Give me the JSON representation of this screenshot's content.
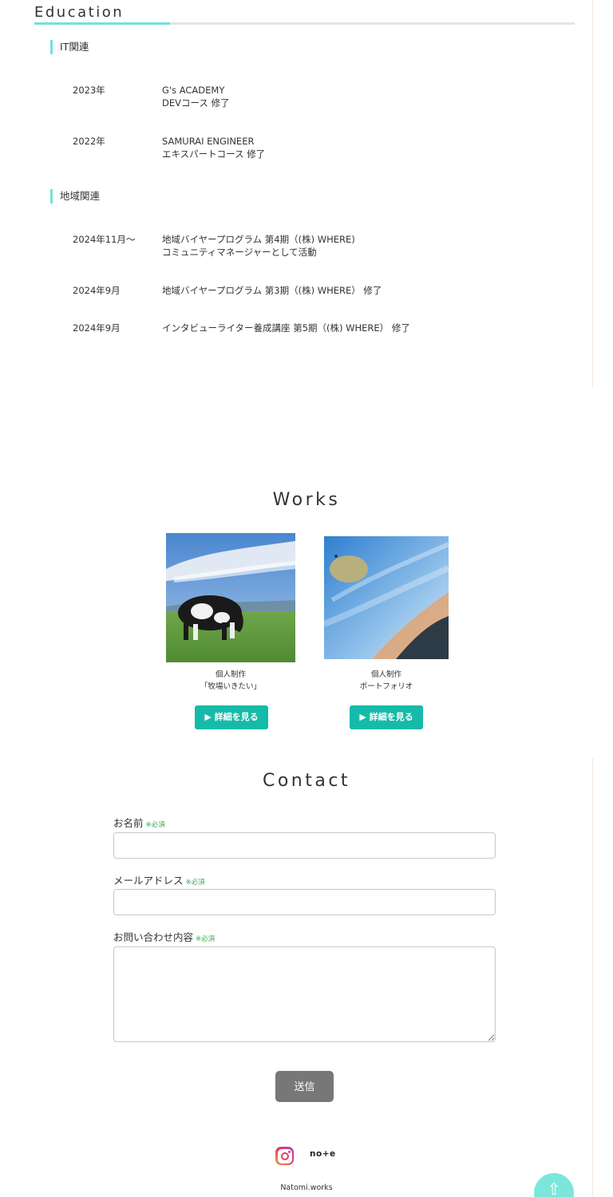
{
  "education": {
    "title": "Education",
    "groups": [
      {
        "heading": "IT関連",
        "entries": [
          {
            "year": "2023年",
            "desc": "G's ACADEMY\nDEVコース 修了"
          },
          {
            "year": "2022年",
            "desc": "SAMURAI ENGINEER\nエキスパートコース 修了"
          }
        ]
      },
      {
        "heading": "地域関連",
        "entries": [
          {
            "year": "2024年11月〜",
            "desc": "地域バイヤープログラム 第4期（(株) WHERE)\nコミュニティマネージャーとして活動"
          },
          {
            "year": "2024年9月",
            "desc": "地域バイヤープログラム 第3期（(株) WHERE） 修了"
          },
          {
            "year": "2024年9月",
            "desc": "インタビューライター養成講座 第5期（(株) WHERE） 修了"
          }
        ]
      }
    ]
  },
  "works": {
    "title": "Works",
    "items": [
      {
        "caption": "個人制作\n「牧場いきたい」",
        "button": "▶ 詳細を見る"
      },
      {
        "caption": "個人制作\nポートフォリオ",
        "button": "▶ 詳細を見る"
      }
    ]
  },
  "contact": {
    "title": "Contact",
    "required_mark": "※必須",
    "name_label": "お名前",
    "email_label": "メールアドレス",
    "message_label": "お問い合わせ内容",
    "submit": "送信"
  },
  "footer": {
    "note": "no+e",
    "site": "Natomi.works",
    "icons": [
      "instagram-icon",
      "note-icon",
      "arrow-up-icon"
    ]
  },
  "colors": {
    "accent": "#6fe3da",
    "button": "#15bba8",
    "required": "#3aa94d",
    "submit": "#777777"
  }
}
